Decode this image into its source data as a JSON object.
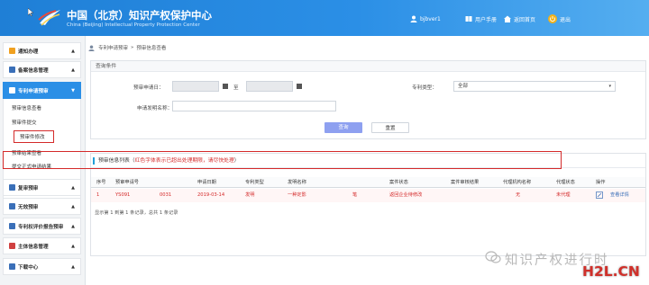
{
  "header": {
    "title": "中国（北京）知识产权保护中心",
    "subtitle": "China (Beijing) Intellectual Property Protection Center",
    "user": "bjbver1",
    "manual": "用户手册",
    "home": "返回首页",
    "logout": "退出",
    "colors": {
      "bg": "#2b8fe6"
    }
  },
  "sidebar": {
    "menus": [
      {
        "label": "通知办理",
        "icon": "bell-icon",
        "color": "#f0a020"
      },
      {
        "label": "备案信息管理",
        "icon": "folder-icon",
        "color": "#3a6fb8"
      },
      {
        "label": "专利申请预审",
        "icon": "file-icon",
        "color": "#ffffff"
      },
      {
        "label": "复审预审",
        "icon": "doc-icon",
        "color": "#3a6fb8"
      },
      {
        "label": "无效预审",
        "icon": "doc-icon",
        "color": "#3a6fb8"
      },
      {
        "label": "专利权评价报告预审",
        "icon": "doc-icon",
        "color": "#3a6fb8"
      },
      {
        "label": "主体信息管理",
        "icon": "user-icon",
        "color": "#d04040"
      },
      {
        "label": "下载中心",
        "icon": "download-icon",
        "color": "#3a6fb8"
      }
    ],
    "submenu": [
      "预审信息查看",
      "预审件提交",
      "预审件修改",
      "预审结果查看",
      "提交正式申请结果"
    ]
  },
  "breadcrumb": {
    "part1": "专利申请预审",
    "sep": "»",
    "part2": "预审信息查看"
  },
  "search": {
    "panel_title": "查询条件",
    "date_label": "预审申请日：",
    "to": "至",
    "type_label": "专利类型：",
    "type_value": "全部",
    "name_label": "申请发明名称：",
    "query_btn": "查询",
    "reset_btn": "重置"
  },
  "list": {
    "title_prefix": "预审信息列表（",
    "title_red": "红色字体表示已超出处理期限，请尽快处理",
    "title_suffix": "）",
    "columns": [
      "序号",
      "预审申请号",
      "申请日期",
      "专利类型",
      "发明名称",
      "案件状态",
      "案件审核结果",
      "代理机构名称",
      "代理状态",
      "操作"
    ],
    "rows": [
      {
        "no": "1",
        "app_no_a": "YS091",
        "app_no_b": "0031",
        "date": "2019-03-14",
        "type": "发明",
        "name_a": "一种定影",
        "name_b": "笔",
        "status": "返回企业待修改",
        "result": "",
        "agency": "无",
        "agent_status": "未代理",
        "action": "查看详情"
      }
    ],
    "pager": "显示第 1 到第 1 条记录，总共 1 条记录"
  },
  "watermark": {
    "text": "知识产权进行时",
    "logo": "H2L.CN"
  }
}
